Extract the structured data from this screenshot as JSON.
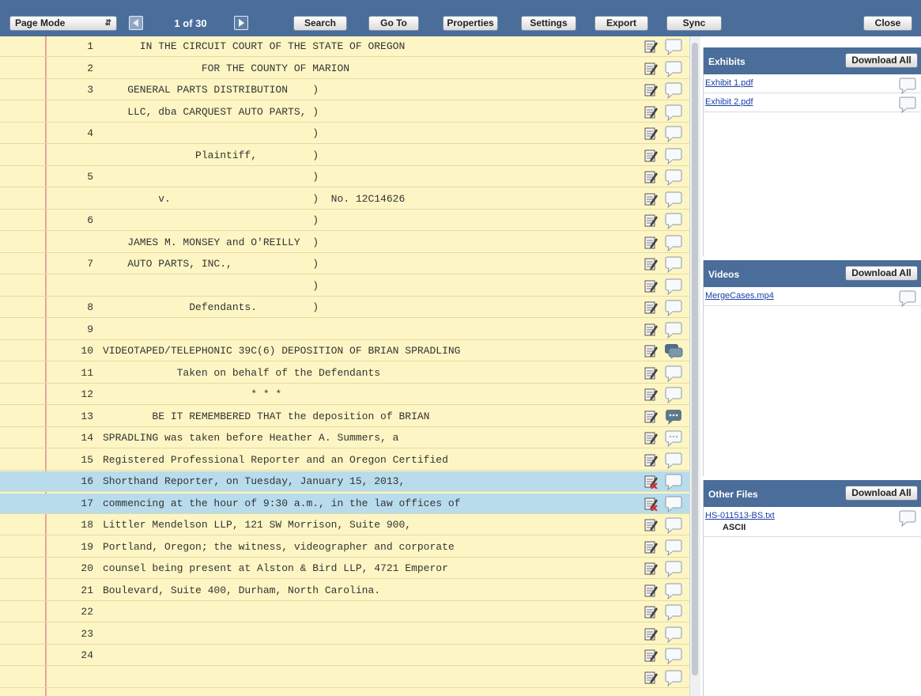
{
  "toolbar": {
    "mode": "Page Mode",
    "page_count": "1 of 30",
    "buttons": [
      {
        "label": "Search",
        "name": "search-button"
      },
      {
        "label": "Go To",
        "name": "goto-button"
      },
      {
        "label": "Properties",
        "name": "properties-button"
      },
      {
        "label": "Settings",
        "name": "settings-button"
      },
      {
        "label": "Export",
        "name": "export-button"
      },
      {
        "label": "Sync",
        "name": "sync-button"
      },
      {
        "label": "Close",
        "name": "close-button"
      }
    ]
  },
  "transcript": {
    "lines": [
      {
        "num": "1",
        "text": "      IN THE CIRCUIT COURT OF THE STATE OF OREGON",
        "note": "note",
        "comment": "empty"
      },
      {
        "num": "2",
        "text": "                FOR THE COUNTY OF MARION",
        "note": "note",
        "comment": "empty"
      },
      {
        "num": "3",
        "text": "    GENERAL PARTS DISTRIBUTION    )",
        "note": "note",
        "comment": "empty"
      },
      {
        "num": "",
        "text": "    LLC, dba CARQUEST AUTO PARTS, )",
        "note": "note",
        "comment": "empty"
      },
      {
        "num": "4",
        "text": "                                  )",
        "note": "note",
        "comment": "empty"
      },
      {
        "num": "",
        "text": "               Plaintiff,         )",
        "note": "note",
        "comment": "empty"
      },
      {
        "num": "5",
        "text": "                                  )",
        "note": "note",
        "comment": "empty"
      },
      {
        "num": "",
        "text": "         v.                       )  No. 12C14626",
        "note": "note",
        "comment": "empty"
      },
      {
        "num": "6",
        "text": "                                  )",
        "note": "note",
        "comment": "empty"
      },
      {
        "num": "",
        "text": "    JAMES M. MONSEY and O'REILLY  )",
        "note": "note",
        "comment": "empty"
      },
      {
        "num": "7",
        "text": "    AUTO PARTS, INC.,             )",
        "note": "note",
        "comment": "empty"
      },
      {
        "num": "",
        "text": "                                  )",
        "note": "note",
        "comment": "empty"
      },
      {
        "num": "8",
        "text": "              Defendants.         )",
        "note": "note",
        "comment": "empty"
      },
      {
        "num": "9",
        "text": "",
        "note": "note",
        "comment": "empty"
      },
      {
        "num": "10",
        "text": "VIDEOTAPED/TELEPHONIC 39C(6) DEPOSITION OF BRIAN SPRADLING",
        "note": "note",
        "comment": "multi"
      },
      {
        "num": "11",
        "text": "            Taken on behalf of the Defendants",
        "note": "note",
        "comment": "empty"
      },
      {
        "num": "12",
        "text": "                        * * *",
        "note": "note",
        "comment": "empty"
      },
      {
        "num": "13",
        "text": "        BE IT REMEMBERED THAT the deposition of BRIAN",
        "note": "note",
        "comment": "filled"
      },
      {
        "num": "14",
        "text": "SPRADLING was taken before Heather A. Summers, a",
        "note": "note",
        "comment": "dots"
      },
      {
        "num": "15",
        "text": "Registered Professional Reporter and an Oregon Certified",
        "note": "note",
        "comment": "empty"
      },
      {
        "num": "16",
        "text": "Shorthand Reporter, on Tuesday, January 15, 2013,",
        "note": "note-x",
        "comment": "empty",
        "highlight": true
      },
      {
        "num": "17",
        "text": "commencing at the hour of 9:30 a.m., in the law offices of",
        "note": "note-x",
        "comment": "empty",
        "highlight": true
      },
      {
        "num": "18",
        "text": "Littler Mendelson LLP, 121 SW Morrison, Suite 900,",
        "note": "note",
        "comment": "empty"
      },
      {
        "num": "19",
        "text": "Portland, Oregon; the witness, videographer and corporate",
        "note": "note",
        "comment": "empty"
      },
      {
        "num": "20",
        "text": "counsel being present at Alston & Bird LLP, 4721 Emperor",
        "note": "note",
        "comment": "empty"
      },
      {
        "num": "21",
        "text": "Boulevard, Suite 400, Durham, North Carolina.",
        "note": "note",
        "comment": "empty"
      },
      {
        "num": "22",
        "text": "",
        "note": "note",
        "comment": "empty"
      },
      {
        "num": "23",
        "text": "",
        "note": "note",
        "comment": "empty"
      },
      {
        "num": "24",
        "text": "",
        "note": "note",
        "comment": "empty"
      },
      {
        "num": "",
        "text": "",
        "note": "note",
        "comment": "empty"
      }
    ]
  },
  "panels": [
    {
      "key": "exhibits",
      "title": "Exhibits",
      "button": "Download All",
      "files": [
        {
          "name": "Exhibit 1.pdf",
          "sub": ""
        },
        {
          "name": "Exhibit 2.pdf",
          "sub": ""
        }
      ]
    },
    {
      "key": "videos",
      "title": "Videos",
      "button": "Download All",
      "files": [
        {
          "name": "MergeCases.mp4",
          "sub": ""
        }
      ]
    },
    {
      "key": "other-files",
      "title": "Other Files",
      "button": "Download All",
      "files": [
        {
          "name": "HS-011513-BS.txt",
          "sub": "ASCII"
        }
      ]
    }
  ],
  "colors": {
    "header_blue": "#4a6d9a",
    "transcript_bg": "#fdf6c4",
    "highlight": "#b8dcec",
    "margin_line": "#e8a3a0",
    "link": "#1a3fa6"
  }
}
